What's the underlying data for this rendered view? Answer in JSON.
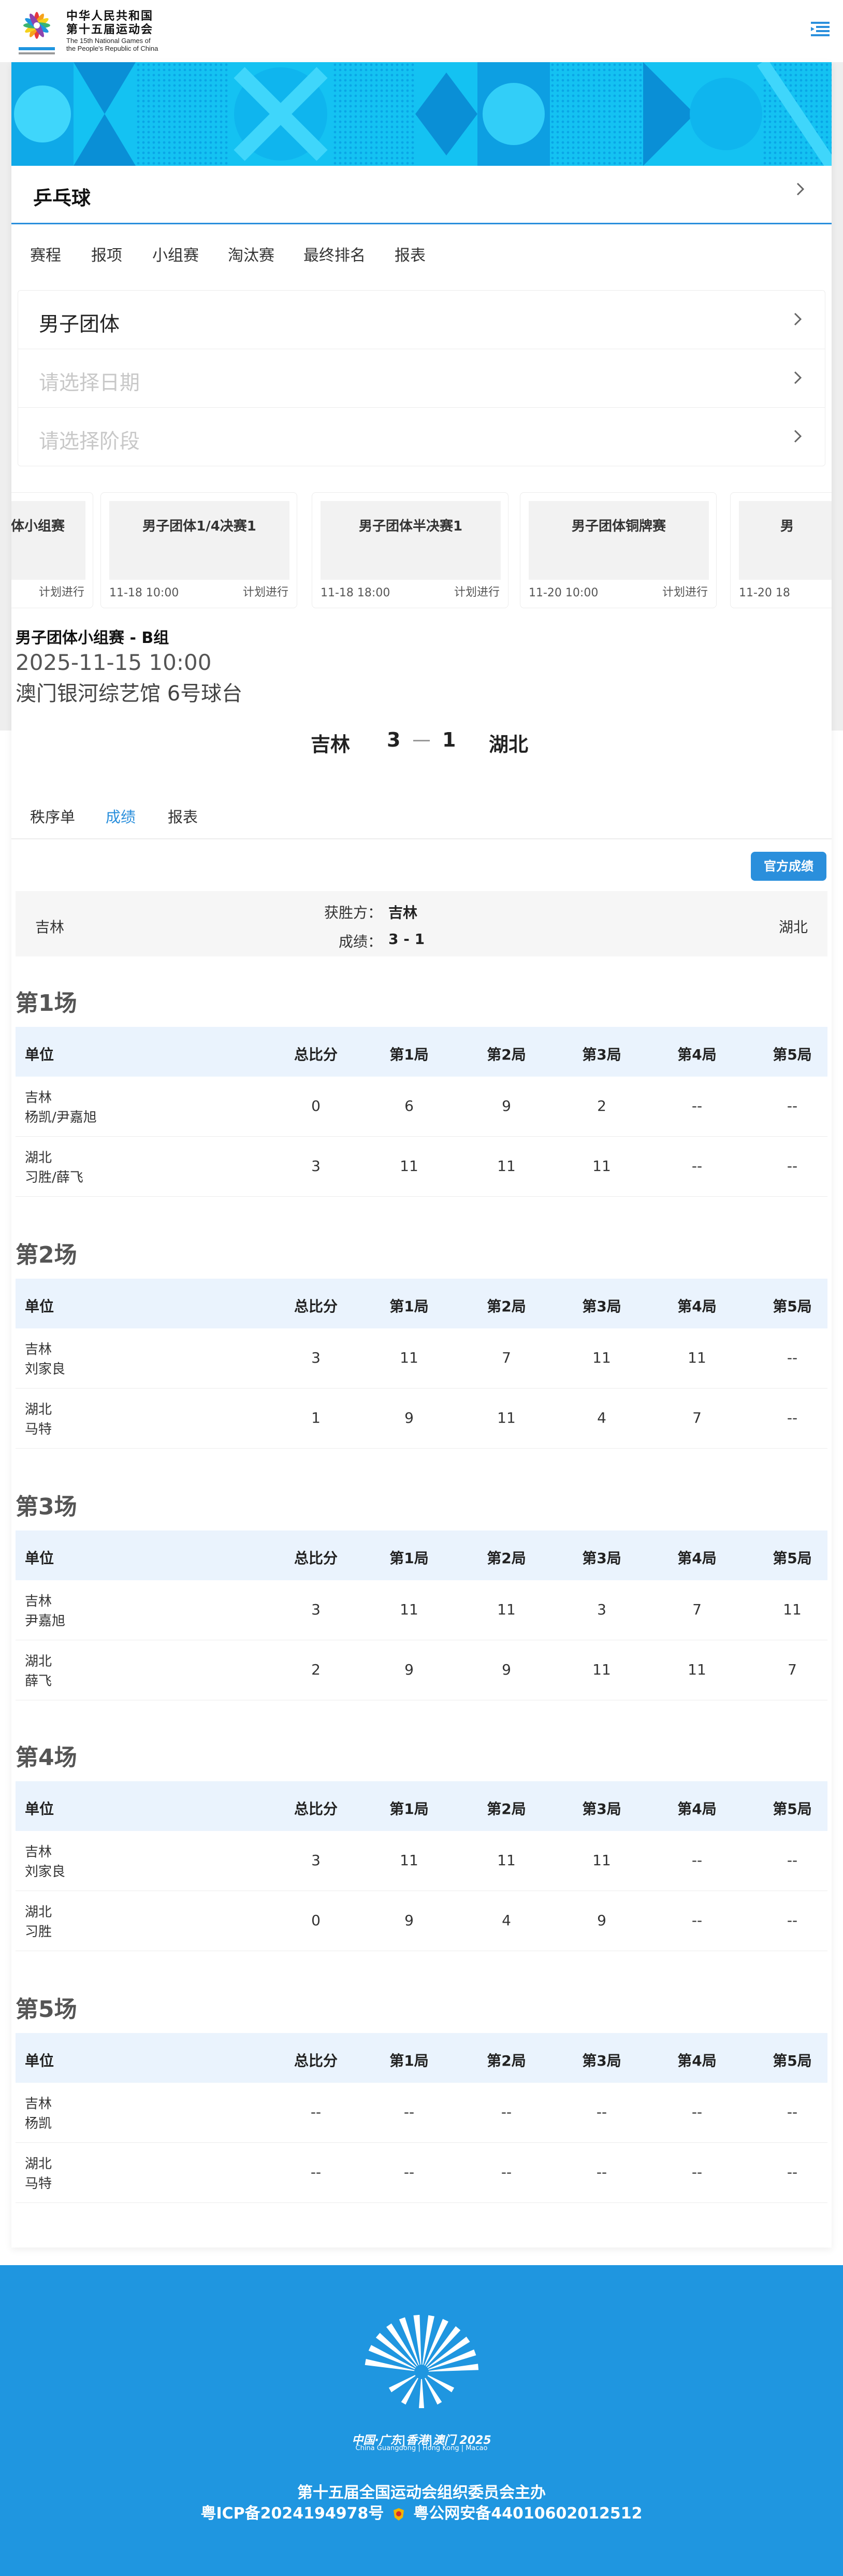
{
  "header": {
    "logo_cn_line1": "中华人民共和国",
    "logo_cn_line2": "第十五届运动会",
    "logo_en_line1": "The 15th National Games of",
    "logo_en_line2": "the People's Republic of China"
  },
  "sport": {
    "title": "乒乓球"
  },
  "nav_tabs": [
    "赛程",
    "报项",
    "小组赛",
    "淘汰赛",
    "最终排名",
    "报表"
  ],
  "selectors": {
    "event": "男子团体",
    "date_placeholder": "请选择日期",
    "stage_placeholder": "请选择阶段"
  },
  "cards": [
    {
      "title": "男子团体小组赛",
      "time": "",
      "status": "计划进行"
    },
    {
      "title": "男子团体1/4决赛1",
      "time": "11-18 10:00",
      "status": "计划进行"
    },
    {
      "title": "男子团体半决赛1",
      "time": "11-18 18:00",
      "status": "计划进行"
    },
    {
      "title": "男子团体铜牌赛",
      "time": "11-20 10:00",
      "status": "计划进行"
    },
    {
      "title": "男",
      "time": "11-20 18",
      "status": ""
    }
  ],
  "match": {
    "title": "男子团体小组赛 - B组",
    "datetime": "2025-11-15 10:00",
    "venue": "澳门银河综艺馆 6号球台",
    "team_a": "吉林",
    "team_b": "湖北",
    "score_a": "3",
    "score_b": "1"
  },
  "sub_tabs": [
    "秩序单",
    "成绩",
    "报表"
  ],
  "official_button": "官方成绩",
  "summary": {
    "team_a": "吉林",
    "team_b": "湖北",
    "winner_label": "获胜方：",
    "winner_value": "吉林",
    "score_label": "成绩：",
    "score_value": "3 - 1"
  },
  "table_headers": [
    "单位",
    "总比分",
    "第1局",
    "第2局",
    "第3局",
    "第4局",
    "第5局"
  ],
  "games": [
    {
      "title": "第1场",
      "rows": [
        {
          "team": "吉林",
          "players": "杨凯/尹嘉旭",
          "cells": [
            "0",
            "6",
            "9",
            "2",
            "--",
            "--"
          ]
        },
        {
          "team": "湖北",
          "players": "习胜/薛飞",
          "cells": [
            "3",
            "11",
            "11",
            "11",
            "--",
            "--"
          ]
        }
      ]
    },
    {
      "title": "第2场",
      "rows": [
        {
          "team": "吉林",
          "players": "刘家良",
          "cells": [
            "3",
            "11",
            "7",
            "11",
            "11",
            "--"
          ]
        },
        {
          "team": "湖北",
          "players": "马特",
          "cells": [
            "1",
            "9",
            "11",
            "4",
            "7",
            "--"
          ]
        }
      ]
    },
    {
      "title": "第3场",
      "rows": [
        {
          "team": "吉林",
          "players": "尹嘉旭",
          "cells": [
            "3",
            "11",
            "11",
            "3",
            "7",
            "11"
          ]
        },
        {
          "team": "湖北",
          "players": "薛飞",
          "cells": [
            "2",
            "9",
            "9",
            "11",
            "11",
            "7"
          ]
        }
      ]
    },
    {
      "title": "第4场",
      "rows": [
        {
          "team": "吉林",
          "players": "刘家良",
          "cells": [
            "3",
            "11",
            "11",
            "11",
            "--",
            "--"
          ]
        },
        {
          "team": "湖北",
          "players": "习胜",
          "cells": [
            "0",
            "9",
            "4",
            "9",
            "--",
            "--"
          ]
        }
      ]
    },
    {
      "title": "第5场",
      "rows": [
        {
          "team": "吉林",
          "players": "杨凯",
          "cells": [
            "--",
            "--",
            "--",
            "--",
            "--",
            "--"
          ]
        },
        {
          "team": "湖北",
          "players": "马特",
          "cells": [
            "--",
            "--",
            "--",
            "--",
            "--",
            "--"
          ]
        }
      ]
    }
  ],
  "footer": {
    "logo_caption": "中国·广东|香港|澳门 2025",
    "logo_caption_en": "China Guangdong | Hong Kong | Macao",
    "host": "第十五届全国运动会组织委员会主办",
    "icp": "粤ICP备2024194978号",
    "police": "粤公网安备44010602012512"
  },
  "colors": {
    "accent": "#2a8fdc",
    "footer_bg": "#1f96e0",
    "table_header_bg": "#eaf3fd"
  }
}
